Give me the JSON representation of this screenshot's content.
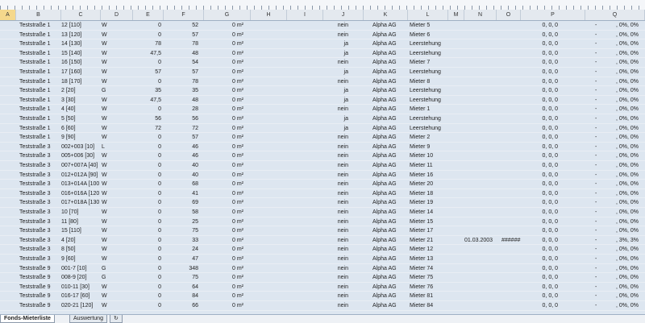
{
  "columns": [
    "A",
    "B",
    "C",
    "D",
    "E",
    "F",
    "G",
    "H",
    "I",
    "J",
    "K",
    "L",
    "M",
    "N",
    "O",
    "P",
    "Q"
  ],
  "rows": [
    [
      "Teststraße 1",
      "12 [110]",
      "W",
      "0",
      "52",
      "0 m²",
      "nein",
      "Alpha AG",
      "Mieter 5",
      "",
      "",
      "0, 0, 0",
      "-",
      ", 0%, 0%"
    ],
    [
      "Teststraße 1",
      "13 [120]",
      "W",
      "0",
      "57",
      "0 m²",
      "nein",
      "Alpha AG",
      "Mieter 6",
      "",
      "",
      "0, 0, 0",
      "-",
      ", 0%, 0%"
    ],
    [
      "Teststraße 1",
      "14 [130]",
      "W",
      "78",
      "78",
      "0 m²",
      "ja",
      "Alpha AG",
      "Leerstehung",
      "",
      "",
      "0, 0, 0",
      "-",
      ", 0%, 0%"
    ],
    [
      "Teststraße 1",
      "15 [140]",
      "W",
      "47,5",
      "48",
      "0 m²",
      "ja",
      "Alpha AG",
      "Leerstehung",
      "",
      "",
      "0, 0, 0",
      "-",
      ", 0%, 0%"
    ],
    [
      "Teststraße 1",
      "16 [150]",
      "W",
      "0",
      "54",
      "0 m²",
      "nein",
      "Alpha AG",
      "Mieter 7",
      "",
      "",
      "0, 0, 0",
      "-",
      ", 0%, 0%"
    ],
    [
      "Teststraße 1",
      "17 [160]",
      "W",
      "57",
      "57",
      "0 m²",
      "ja",
      "Alpha AG",
      "Leerstehung",
      "",
      "",
      "0, 0, 0",
      "-",
      ", 0%, 0%"
    ],
    [
      "Teststraße 1",
      "18 [170]",
      "W",
      "0",
      "78",
      "0 m²",
      "nein",
      "Alpha AG",
      "Mieter 8",
      "",
      "",
      "0, 0, 0",
      "-",
      ", 0%, 0%"
    ],
    [
      "Teststraße 1",
      "2 [20]",
      "G",
      "35",
      "35",
      "0 m²",
      "ja",
      "Alpha AG",
      "Leerstehung",
      "",
      "",
      "0, 0, 0",
      "-",
      ", 0%, 0%"
    ],
    [
      "Teststraße 1",
      "3 [30]",
      "W",
      "47,5",
      "48",
      "0 m²",
      "ja",
      "Alpha AG",
      "Leerstehung",
      "",
      "",
      "0, 0, 0",
      "-",
      ", 0%, 0%"
    ],
    [
      "Teststraße 1",
      "4 [40]",
      "W",
      "0",
      "28",
      "0 m²",
      "nein",
      "Alpha AG",
      "Mieter 1",
      "",
      "",
      "0, 0, 0",
      "-",
      ", 0%, 0%"
    ],
    [
      "Teststraße 1",
      "5 [50]",
      "W",
      "56",
      "56",
      "0 m²",
      "ja",
      "Alpha AG",
      "Leerstehung",
      "",
      "",
      "0, 0, 0",
      "-",
      ", 0%, 0%"
    ],
    [
      "Teststraße 1",
      "6 [60]",
      "W",
      "72",
      "72",
      "0 m²",
      "ja",
      "Alpha AG",
      "Leerstehung",
      "",
      "",
      "0, 0, 0",
      "-",
      ", 0%, 0%"
    ],
    [
      "Teststraße 1",
      "9 [90]",
      "W",
      "0",
      "57",
      "0 m²",
      "nein",
      "Alpha AG",
      "Mieter 2",
      "",
      "",
      "0, 0, 0",
      "-",
      ", 0%, 0%"
    ],
    [
      "Teststraße 3",
      "002+003 [10]",
      "L",
      "0",
      "46",
      "0 m²",
      "nein",
      "Alpha AG",
      "Mieter 9",
      "",
      "",
      "0, 0, 0",
      "-",
      ", 0%, 0%"
    ],
    [
      "Teststraße 3",
      "005+006 [30]",
      "W",
      "0",
      "46",
      "0 m²",
      "nein",
      "Alpha AG",
      "Mieter 10",
      "",
      "",
      "0, 0, 0",
      "-",
      ", 0%, 0%"
    ],
    [
      "Teststraße 3",
      "007+007A [40]",
      "W",
      "0",
      "40",
      "0 m²",
      "nein",
      "Alpha AG",
      "Mieter 11",
      "",
      "",
      "0, 0, 0",
      "-",
      ", 0%, 0%"
    ],
    [
      "Teststraße 3",
      "012+012A [90]",
      "W",
      "0",
      "40",
      "0 m²",
      "nein",
      "Alpha AG",
      "Mieter 16",
      "",
      "",
      "0, 0, 0",
      "-",
      ", 0%, 0%"
    ],
    [
      "Teststraße 3",
      "013+014A [100",
      "W",
      "0",
      "68",
      "0 m²",
      "nein",
      "Alpha AG",
      "Mieter 20",
      "",
      "",
      "0, 0, 0",
      "-",
      ", 0%, 0%"
    ],
    [
      "Teststraße 3",
      "016+016A [120",
      "W",
      "0",
      "41",
      "0 m²",
      "nein",
      "Alpha AG",
      "Mieter 18",
      "",
      "",
      "0, 0, 0",
      "-",
      ", 0%, 0%"
    ],
    [
      "Teststraße 3",
      "017+018A [130",
      "W",
      "0",
      "69",
      "0 m²",
      "nein",
      "Alpha AG",
      "Mieter 19",
      "",
      "",
      "0, 0, 0",
      "-",
      ", 0%, 0%"
    ],
    [
      "Teststraße 3",
      "10 [70]",
      "W",
      "0",
      "58",
      "0 m²",
      "nein",
      "Alpha AG",
      "Mieter 14",
      "",
      "",
      "0, 0, 0",
      "-",
      ", 0%, 0%"
    ],
    [
      "Teststraße 3",
      "11 [80]",
      "W",
      "0",
      "25",
      "0 m²",
      "nein",
      "Alpha AG",
      "Mieter 15",
      "",
      "",
      "0, 0, 0",
      "-",
      ", 0%, 0%"
    ],
    [
      "Teststraße 3",
      "15 [110]",
      "W",
      "0",
      "75",
      "0 m²",
      "nein",
      "Alpha AG",
      "Mieter 17",
      "",
      "",
      "0, 0, 0",
      "-",
      ", 0%, 0%"
    ],
    [
      "Teststraße 3",
      "4 [20]",
      "W",
      "0",
      "33",
      "0 m²",
      "nein",
      "Alpha AG",
      "Mieter 21",
      "01.03.2003",
      "######",
      "0, 0, 0",
      "-",
      ", 3%, 3%"
    ],
    [
      "Teststraße 3",
      "8 [50]",
      "W",
      "0",
      "24",
      "0 m²",
      "nein",
      "Alpha AG",
      "Mieter 12",
      "",
      "",
      "0, 0, 0",
      "-",
      ", 0%, 0%"
    ],
    [
      "Teststraße 3",
      "9 [60]",
      "W",
      "0",
      "47",
      "0 m²",
      "nein",
      "Alpha AG",
      "Mieter 13",
      "",
      "",
      "0, 0, 0",
      "-",
      ", 0%, 0%"
    ],
    [
      "Teststraße 9",
      "001-7 [10]",
      "G",
      "0",
      "348",
      "0 m²",
      "nein",
      "Alpha AG",
      "Mieter 74",
      "",
      "",
      "0, 0, 0",
      "-",
      ", 0%, 0%"
    ],
    [
      "Teststraße 9",
      "008-9 [20]",
      "G",
      "0",
      "75",
      "0 m²",
      "nein",
      "Alpha AG",
      "Mieter 75",
      "",
      "",
      "0, 0, 0",
      "-",
      ", 0%, 0%"
    ],
    [
      "Teststraße 9",
      "010-11 [30]",
      "W",
      "0",
      "64",
      "0 m²",
      "nein",
      "Alpha AG",
      "Mieter 76",
      "",
      "",
      "0, 0, 0",
      "-",
      ", 0%, 0%"
    ],
    [
      "Teststraße 9",
      "016-17 [60]",
      "W",
      "0",
      "84",
      "0 m²",
      "nein",
      "Alpha AG",
      "Mieter 81",
      "",
      "",
      "0, 0, 0",
      "-",
      ", 0%, 0%"
    ],
    [
      "Teststraße 9",
      "020-21 [120]",
      "W",
      "0",
      "66",
      "0 m²",
      "nein",
      "Alpha AG",
      "Mieter 84",
      "",
      "",
      "0, 0, 0",
      "-",
      ", 0%, 0%"
    ]
  ],
  "tabs": [
    "Fonds-Mieterliste",
    "Auswertung",
    "↻"
  ]
}
